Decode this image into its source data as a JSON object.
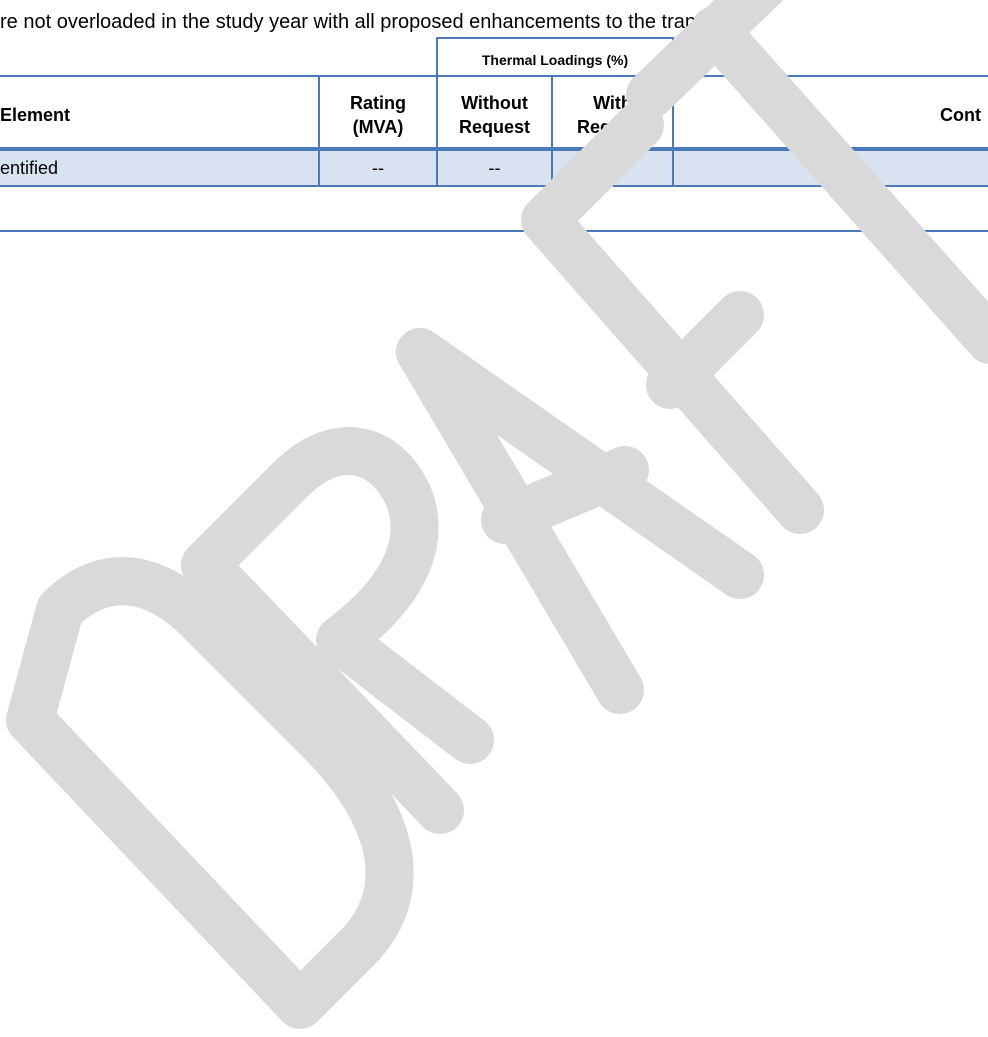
{
  "intro_text": "re not overloaded in the study year with all proposed enhancements to the transmis",
  "table": {
    "group_header": "Thermal Loadings (%)",
    "headers": {
      "element": "Element",
      "rating_line1": "Rating",
      "rating_line2": "(MVA)",
      "without_line1": "Without",
      "without_line2": "Request",
      "with_line1": "With",
      "with_line2": "Request",
      "contingency": "Cont"
    },
    "rows": [
      {
        "element": "entified",
        "rating": "--",
        "without": "--",
        "with": "--",
        "contingency": ""
      }
    ]
  },
  "watermark_text": "DRAFT",
  "colors": {
    "rule": "#4a7ab8",
    "row_fill": "#d9e2f1",
    "watermark": "#d9d9d9"
  }
}
